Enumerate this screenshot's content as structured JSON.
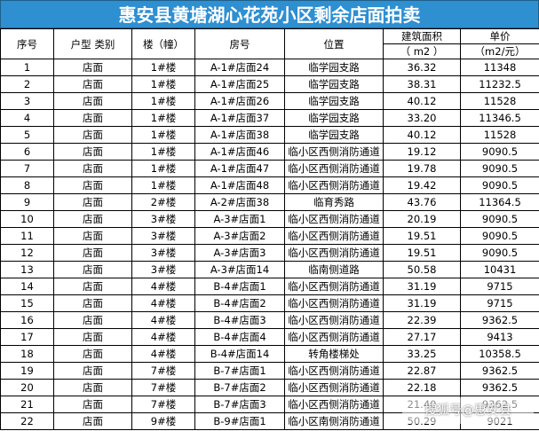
{
  "title": "惠安县黄塘湖心花苑小区剩余店面拍卖",
  "headers": {
    "seq": "序号",
    "type": "户型 类别",
    "building": "楼（幢）",
    "room": "房号",
    "location": "位置",
    "area_top": "建筑面积",
    "area_unit": "（ m2 ）",
    "price_top": "单价",
    "price_unit": "（m2/元）"
  },
  "rows": [
    {
      "seq": "1",
      "type": "店面",
      "building": "1#楼",
      "room": "A-1#店面24",
      "location": "临学园支路",
      "area": "36.32",
      "price": "11348"
    },
    {
      "seq": "2",
      "type": "店面",
      "building": "1#楼",
      "room": "A-1#店面25",
      "location": "临学园支路",
      "area": "38.31",
      "price": "11232.5"
    },
    {
      "seq": "3",
      "type": "店面",
      "building": "1#楼",
      "room": "A-1#店面26",
      "location": "临学园支路",
      "area": "40.12",
      "price": "11528"
    },
    {
      "seq": "4",
      "type": "店面",
      "building": "1#楼",
      "room": "A-1#店面37",
      "location": "临学园支路",
      "area": "33.20",
      "price": "11346.5"
    },
    {
      "seq": "5",
      "type": "店面",
      "building": "1#楼",
      "room": "A-1#店面38",
      "location": "临学园支路",
      "area": "40.12",
      "price": "11528"
    },
    {
      "seq": "6",
      "type": "店面",
      "building": "1#楼",
      "room": "A-1#店面46",
      "location": "临小区西侧消防通道",
      "area": "19.12",
      "price": "9090.5"
    },
    {
      "seq": "7",
      "type": "店面",
      "building": "1#楼",
      "room": "A-1#店面47",
      "location": "临小区西侧消防通道",
      "area": "19.78",
      "price": "9090.5"
    },
    {
      "seq": "8",
      "type": "店面",
      "building": "1#楼",
      "room": "A-1#店面48",
      "location": "临小区西侧消防通道",
      "area": "19.42",
      "price": "9090.5"
    },
    {
      "seq": "9",
      "type": "店面",
      "building": "2#楼",
      "room": "A-2#店面38",
      "location": "临育秀路",
      "area": "43.76",
      "price": "11364.5"
    },
    {
      "seq": "10",
      "type": "店面",
      "building": "3#楼",
      "room": "A-3#店面1",
      "location": "临小区西侧消防通道",
      "area": "20.19",
      "price": "9090.5"
    },
    {
      "seq": "11",
      "type": "店面",
      "building": "3#楼",
      "room": "A-3#店面2",
      "location": "临小区西侧消防通道",
      "area": "19.51",
      "price": "9090.5"
    },
    {
      "seq": "12",
      "type": "店面",
      "building": "3#楼",
      "room": "A-3#店面3",
      "location": "临小区西侧消防通道",
      "area": "19.51",
      "price": "9090.5"
    },
    {
      "seq": "13",
      "type": "店面",
      "building": "3#楼",
      "room": "A-3#店面14",
      "location": "临南侧道路",
      "area": "50.58",
      "price": "10431"
    },
    {
      "seq": "14",
      "type": "店面",
      "building": "4#楼",
      "room": "B-4#店面1",
      "location": "临小区西侧消防通道",
      "area": "31.19",
      "price": "9715"
    },
    {
      "seq": "15",
      "type": "店面",
      "building": "4#楼",
      "room": "B-4#店面2",
      "location": "临小区西侧消防通道",
      "area": "31.19",
      "price": "9715"
    },
    {
      "seq": "16",
      "type": "店面",
      "building": "4#楼",
      "room": "B-4#店面3",
      "location": "临小区西侧消防通道",
      "area": "22.39",
      "price": "9362.5"
    },
    {
      "seq": "17",
      "type": "店面",
      "building": "4#楼",
      "room": "B-4#店面4",
      "location": "临小区西侧消防通道",
      "area": "27.17",
      "price": "9413"
    },
    {
      "seq": "18",
      "type": "店面",
      "building": "4#楼",
      "room": "B-4#店面14",
      "location": "转角楼梯处",
      "area": "33.25",
      "price": "10358.5"
    },
    {
      "seq": "19",
      "type": "店面",
      "building": "7#楼",
      "room": "B-7#店面1",
      "location": "临小区西侧消防通道",
      "area": "22.87",
      "price": "9362.5"
    },
    {
      "seq": "20",
      "type": "店面",
      "building": "7#楼",
      "room": "B-7#店面2",
      "location": "临小区西侧消防通道",
      "area": "22.18",
      "price": "9362.5"
    },
    {
      "seq": "21",
      "type": "店面",
      "building": "7#楼",
      "room": "B-7#店面3",
      "location": "临小区西侧消防通道",
      "area": "21.40",
      "price": "9362.5"
    },
    {
      "seq": "22",
      "type": "店面",
      "building": "9#楼",
      "room": "B-9#店面1",
      "location": "临小区南侧消防通道",
      "area": "50.29",
      "price": "9021"
    }
  ],
  "watermark": "搜狐号@惠安县"
}
